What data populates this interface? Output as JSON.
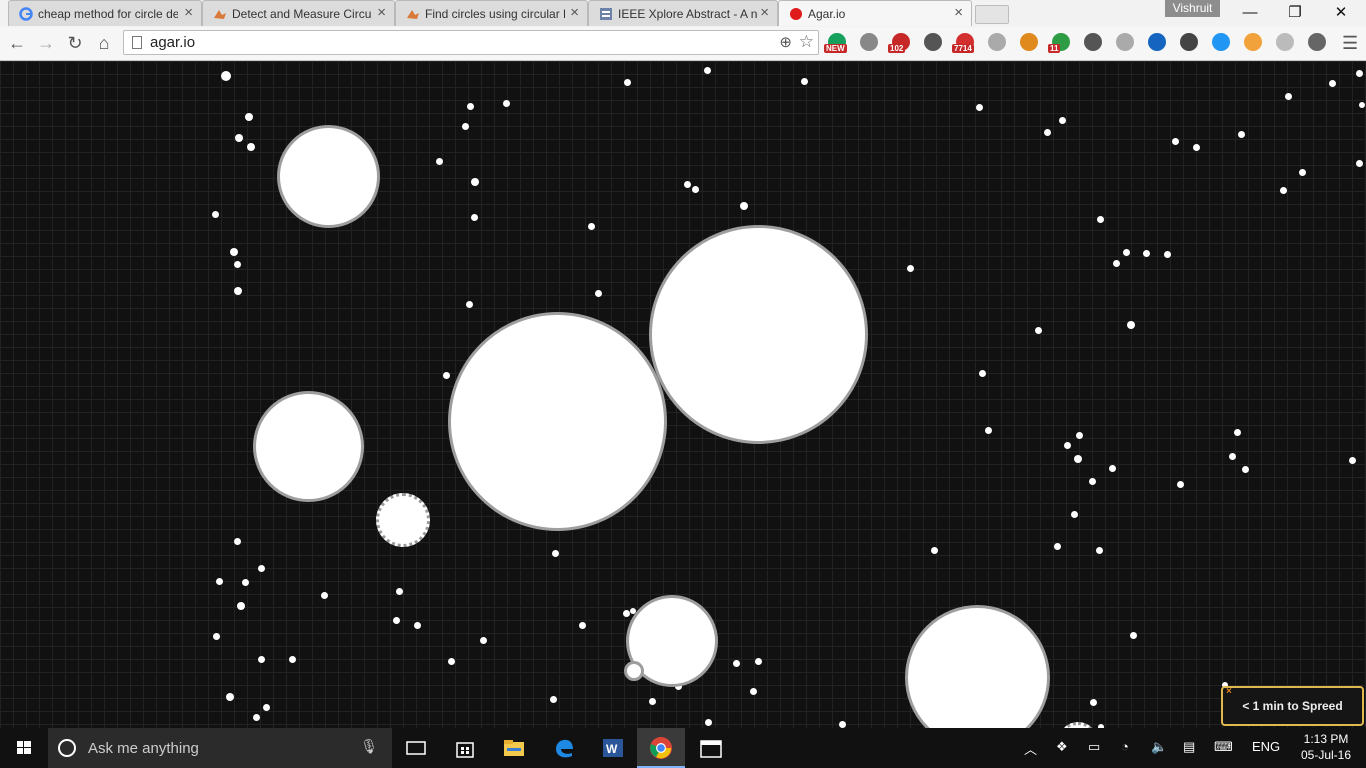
{
  "tabs": [
    {
      "label": "cheap method for circle de",
      "icon": "google-icon"
    },
    {
      "label": "Detect and Measure Circu",
      "icon": "matlab-icon"
    },
    {
      "label": "Find circles using circular H",
      "icon": "matlab-icon"
    },
    {
      "label": "IEEE Xplore Abstract - A ne",
      "icon": "ieee-icon"
    },
    {
      "label": "Agar.io",
      "icon": "agario-icon",
      "active": true
    }
  ],
  "profile_name": "Vishruit",
  "window_controls": {
    "minimize": "—",
    "restore": "❐",
    "close": "✕"
  },
  "tab_close_glyph": "×",
  "omnibox": {
    "url": "agar.io"
  },
  "extensions": [
    {
      "name": "grammarly-icon",
      "badge": "NEW",
      "color": "#15a05b"
    },
    {
      "name": "mail-checker-icon",
      "badge": "",
      "color": "#888888"
    },
    {
      "name": "notifications-icon",
      "badge": "102",
      "color": "#c62828"
    },
    {
      "name": "lightbulb-icon",
      "badge": "",
      "color": "#555555"
    },
    {
      "name": "gmail-icon",
      "badge": "7714",
      "color": "#d32f2f"
    },
    {
      "name": "play-icon",
      "badge": "",
      "color": "#aaaaaa"
    },
    {
      "name": "basket-icon",
      "badge": "",
      "color": "#e08a1e"
    },
    {
      "name": "pushbullet-icon",
      "badge": "11",
      "color": "#2e9b45"
    },
    {
      "name": "inbox-icon",
      "badge": "",
      "color": "#555555"
    },
    {
      "name": "cloud-icon",
      "badge": "",
      "color": "#aaaaaa"
    },
    {
      "name": "camera-icon",
      "badge": "",
      "color": "#1565c0"
    },
    {
      "name": "puzzle-icon",
      "badge": "",
      "color": "#444444"
    },
    {
      "name": "screenshot-icon",
      "badge": "",
      "color": "#2196f3"
    },
    {
      "name": "character-icon",
      "badge": "",
      "color": "#f2a23a"
    },
    {
      "name": "m-icon",
      "badge": "",
      "color": "#bbbbbb"
    },
    {
      "name": "books-icon",
      "badge": "",
      "color": "#666666"
    }
  ],
  "notice": {
    "text": "< 1 min to Spreed",
    "close_glyph": "×"
  },
  "taskbar": {
    "search_placeholder": "Ask me anything",
    "language": "ENG",
    "time": "1:13 PM",
    "date": "05-Jul-16"
  }
}
